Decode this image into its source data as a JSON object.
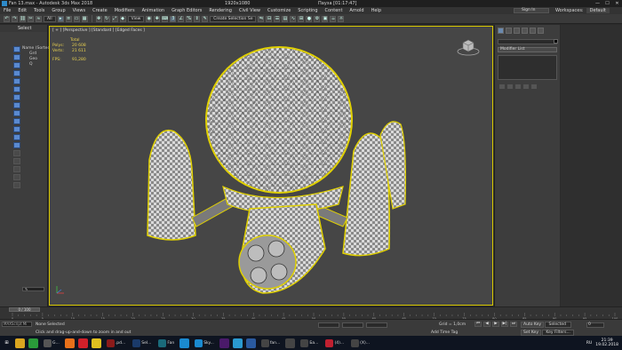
{
  "window": {
    "title": "Fan 13.max - Autodesk 3ds Max 2018",
    "center_title": "1920x1080",
    "pause_text": "Пауза [01:17:47]",
    "controls": [
      "minimize",
      "maximize",
      "close"
    ]
  },
  "menu": {
    "items": [
      "File",
      "Edit",
      "Tools",
      "Group",
      "Views",
      "Create",
      "Modifiers",
      "Animation",
      "Graph Editors",
      "Rendering",
      "Civil View",
      "Customize",
      "Scripting",
      "Content",
      "Arnold",
      "Help"
    ],
    "sign_in": "Sign In",
    "workspaces_label": "Workspaces:",
    "workspaces_value": "Default"
  },
  "toolbar": {
    "filter_value": "All",
    "view_value": "View",
    "selection_set": "Create Selection Se"
  },
  "left_panel": {
    "header": "Select",
    "tree": [
      "Name (Sorted ▲",
      "Grd",
      "Geo",
      "Q"
    ],
    "footer": "✎"
  },
  "viewport": {
    "label": "[ + ] [Perspective ] [Standard ] [Edged Faces ]",
    "stats": {
      "total_label": "Total",
      "polys_label": "Polys:",
      "polys_value": "20 608",
      "verts_label": "Verts:",
      "verts_value": "21 611",
      "fps_label": "FPS:",
      "fps_value": "91,280"
    }
  },
  "right_panel": {
    "modifier_list": "Modifier List"
  },
  "timeline": {
    "slider": "0 / 100",
    "ticks": [
      "0",
      "5",
      "10",
      "15",
      "20",
      "25",
      "30",
      "35",
      "40",
      "45",
      "50",
      "55",
      "60",
      "65",
      "70",
      "75",
      "80",
      "85",
      "90",
      "95",
      "100"
    ]
  },
  "status": {
    "maxscript": "MAXScript Mi",
    "selection": "None Selected",
    "hint": "Click and drag-up-and-down to zoom in and out",
    "grid": "Grid = 1,0cm",
    "add_time_tag": "Add Time Tag",
    "auto_key": "Auto Key",
    "set_key": "Set Key",
    "selected": "Selected",
    "key_filters": "Key Filters...",
    "frame": "0"
  },
  "taskbar": {
    "apps": [
      {
        "name": "start",
        "label": "",
        "color": "#0e1420"
      },
      {
        "name": "folder",
        "label": "",
        "color": "#d9a520"
      },
      {
        "name": "app-green",
        "label": "",
        "color": "#2a9a3a"
      },
      {
        "name": "app-g",
        "label": "G...",
        "color": "#555"
      },
      {
        "name": "firefox",
        "label": "",
        "color": "#e8701a"
      },
      {
        "name": "opera",
        "label": "",
        "color": "#d0202a"
      },
      {
        "name": "chrome",
        "label": "",
        "color": "#e0c020"
      },
      {
        "name": "pdf",
        "label": ".pd...",
        "color": "#8a1a1a"
      },
      {
        "name": "photoshop",
        "label": "Sel...",
        "color": "#1a3a6a"
      },
      {
        "name": "3dsmax",
        "label": "Fan",
        "color": "#1a6a7a"
      },
      {
        "name": "skype-1",
        "label": "",
        "color": "#1a8ad0"
      },
      {
        "name": "skype-2",
        "label": "Sky...",
        "color": "#1a8ad0"
      },
      {
        "name": "premiere",
        "label": "",
        "color": "#4a1a6a"
      },
      {
        "name": "telegram",
        "label": "",
        "color": "#2a9ad0"
      },
      {
        "name": "word",
        "label": "",
        "color": "#2a5aa0"
      },
      {
        "name": "app-fan",
        "label": "fan...",
        "color": "#444"
      },
      {
        "name": "app-x",
        "label": "",
        "color": "#444"
      },
      {
        "name": "app-ba",
        "label": "Ба...",
        "color": "#444"
      },
      {
        "name": "app-4",
        "label": "(4)...",
        "color": "#c02030"
      },
      {
        "name": "app-x2",
        "label": "(X)...",
        "color": "#444"
      }
    ],
    "language": "RU",
    "time": "21:39",
    "date": "19.02.2018"
  }
}
